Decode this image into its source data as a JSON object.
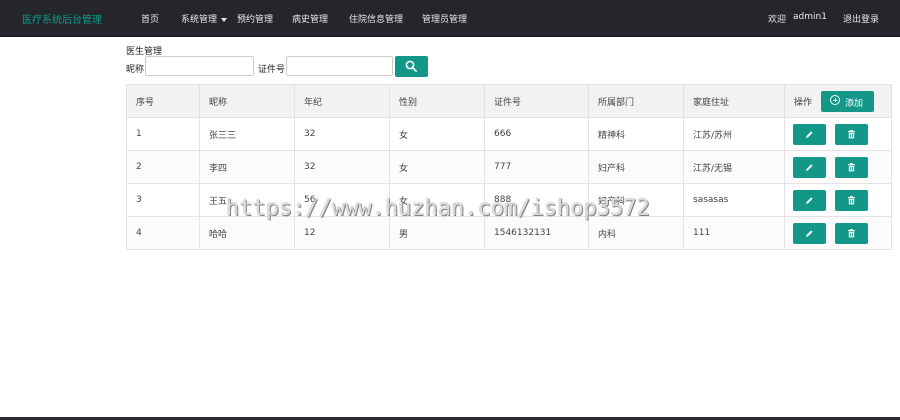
{
  "nav": {
    "brand": "医疗系统后台管理",
    "items": [
      "首页",
      "系统管理",
      "预约管理",
      "病史管理",
      "住院信息管理",
      "管理员管理"
    ],
    "welcome": "欢迎",
    "user": "admin1",
    "logout": "退出登录"
  },
  "filter": {
    "title": "医生管理",
    "nickname_label": "昵称:",
    "nickname_value": "",
    "idno_label": "证件号:",
    "idno_value": ""
  },
  "table": {
    "headers": [
      "序号",
      "昵称",
      "年纪",
      "性别",
      "证件号",
      "所属部门",
      "家庭住址",
      "操作"
    ],
    "add_label": "添加",
    "rows": [
      [
        "1",
        "张三三",
        "32",
        "女",
        "666",
        "精神科",
        "江苏/苏州"
      ],
      [
        "2",
        "李四",
        "32",
        "女",
        "777",
        "妇产科",
        "江苏/无锡"
      ],
      [
        "3",
        "王五",
        "56",
        "女",
        "888",
        "妇产科",
        "sasasas"
      ],
      [
        "4",
        "哈哈",
        "12",
        "男",
        "1546132131",
        "内科",
        "111"
      ]
    ]
  },
  "watermark": "https://www.huzhan.com/ishop3572",
  "colors": {
    "navbar": "#24262b",
    "brand": "#0f9a8a",
    "accent": "#129789"
  }
}
